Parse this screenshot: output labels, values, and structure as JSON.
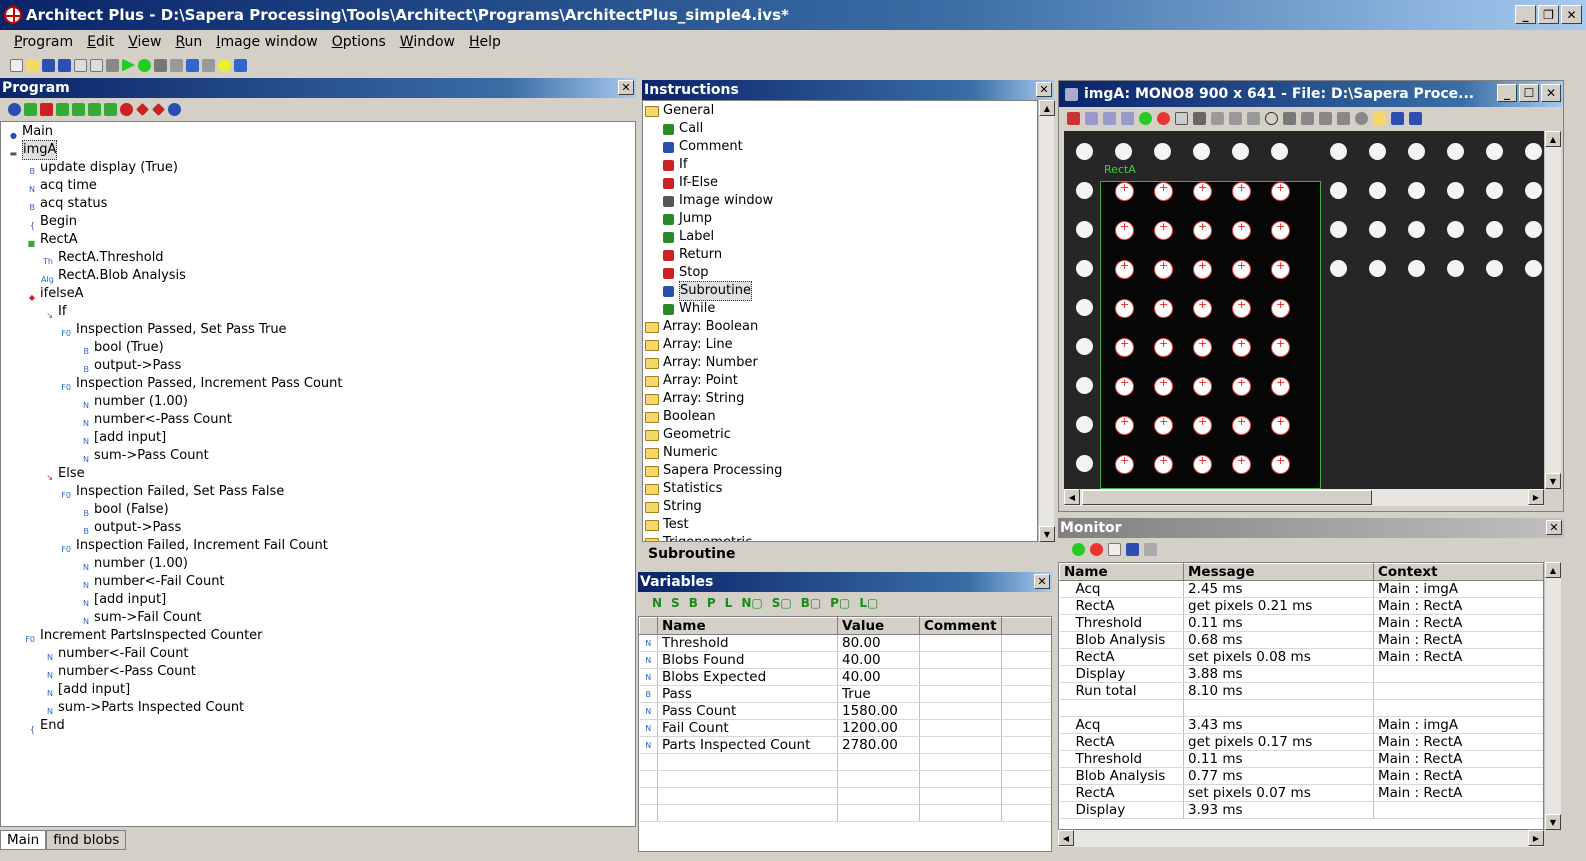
{
  "window": {
    "title": "Architect Plus - D:\\Sapera Processing\\Tools\\Architect\\Programs\\ArchitectPlus_simple4.ivs*"
  },
  "menu": [
    "Program",
    "Edit",
    "View",
    "Run",
    "Image window",
    "Options",
    "Window",
    "Help"
  ],
  "program_panel": {
    "title": "Program",
    "tree": [
      {
        "label": "Main",
        "icon": "subroutine-icon",
        "depth": 0
      },
      {
        "label": "imgA",
        "icon": "image-window-icon",
        "depth": 0
      },
      {
        "label": "update display (True)",
        "icon": "bool-icon",
        "depth": 1
      },
      {
        "label": "acq time",
        "icon": "number-icon",
        "depth": 1
      },
      {
        "label": "acq status",
        "icon": "bool-icon",
        "depth": 1
      },
      {
        "label": "Begin",
        "icon": "brace-icon",
        "depth": 1
      },
      {
        "label": "RectA",
        "icon": "rect-icon",
        "depth": 1
      },
      {
        "label": "RectA.Threshold",
        "icon": "threshold-icon",
        "depth": 2
      },
      {
        "label": "RectA.Blob Analysis",
        "icon": "algorithm-icon",
        "depth": 2
      },
      {
        "label": "ifelseA",
        "icon": "if-icon",
        "depth": 1
      },
      {
        "label": "If",
        "icon": "branch-icon",
        "depth": 2
      },
      {
        "label": "Inspection Passed, Set Pass True",
        "icon": "function-icon",
        "depth": 3
      },
      {
        "label": "bool (True)",
        "icon": "bool-icon",
        "depth": 4
      },
      {
        "label": "output->Pass",
        "icon": "bool-icon",
        "depth": 4
      },
      {
        "label": "Inspection Passed, Increment Pass Count",
        "icon": "function-icon",
        "depth": 3
      },
      {
        "label": "number (1.00)",
        "icon": "number-icon",
        "depth": 4
      },
      {
        "label": "number<-Pass Count",
        "icon": "number-icon",
        "depth": 4
      },
      {
        "label": "[add input]",
        "icon": "number-icon",
        "depth": 4
      },
      {
        "label": "sum->Pass Count",
        "icon": "number-icon",
        "depth": 4
      },
      {
        "label": "Else",
        "icon": "branch-red-icon",
        "depth": 2
      },
      {
        "label": "Inspection Failed, Set Pass False",
        "icon": "function-icon",
        "depth": 3
      },
      {
        "label": "bool (False)",
        "icon": "bool-icon",
        "depth": 4
      },
      {
        "label": "output->Pass",
        "icon": "bool-icon",
        "depth": 4
      },
      {
        "label": "Inspection Failed, Increment Fail Count",
        "icon": "function-icon",
        "depth": 3
      },
      {
        "label": "number (1.00)",
        "icon": "number-icon",
        "depth": 4
      },
      {
        "label": "number<-Fail Count",
        "icon": "number-icon",
        "depth": 4
      },
      {
        "label": "[add input]",
        "icon": "number-icon",
        "depth": 4
      },
      {
        "label": "sum->Fail Count",
        "icon": "number-icon",
        "depth": 4
      },
      {
        "label": "Increment PartsInspected Counter",
        "icon": "function-icon",
        "depth": 1
      },
      {
        "label": "number<-Fail Count",
        "icon": "number-icon",
        "depth": 2
      },
      {
        "label": "number<-Pass Count",
        "icon": "number-icon",
        "depth": 2
      },
      {
        "label": "[add input]",
        "icon": "number-icon",
        "depth": 2
      },
      {
        "label": "sum->Parts Inspected Count",
        "icon": "number-icon",
        "depth": 2
      },
      {
        "label": "End",
        "icon": "brace-icon",
        "depth": 1
      }
    ],
    "tabs": [
      "Main",
      "find blobs"
    ]
  },
  "instructions_panel": {
    "title": "Instructions",
    "root": "General",
    "general_items": [
      "Call",
      "Comment",
      "If",
      "If-Else",
      "Image window",
      "Jump",
      "Label",
      "Return",
      "Stop",
      "Subroutine",
      "While"
    ],
    "folders": [
      "Array: Boolean",
      "Array: Line",
      "Array: Number",
      "Array: Point",
      "Array: String",
      "Boolean",
      "Geometric",
      "Numeric",
      "Sapera Processing",
      "Statistics",
      "String",
      "Test",
      "Trigonometric"
    ],
    "selected": "Subroutine",
    "status": "Subroutine"
  },
  "variables_panel": {
    "title": "Variables",
    "filter_buttons": [
      "N",
      "S",
      "B",
      "P",
      "L",
      "N▢",
      "S▢",
      "B▢",
      "P▢",
      "L▢"
    ],
    "columns": [
      "Name",
      "Value",
      "Comment"
    ],
    "rows": [
      {
        "type": "N",
        "name": "Threshold",
        "value": "80.00"
      },
      {
        "type": "N",
        "name": "Blobs Found",
        "value": "40.00"
      },
      {
        "type": "N",
        "name": "Blobs Expected",
        "value": "40.00"
      },
      {
        "type": "B",
        "name": "Pass",
        "value": "True"
      },
      {
        "type": "N",
        "name": "Pass Count",
        "value": "1580.00"
      },
      {
        "type": "N",
        "name": "Fail Count",
        "value": "1200.00"
      },
      {
        "type": "N",
        "name": "Parts Inspected Count",
        "value": "2780.00"
      }
    ]
  },
  "image_window": {
    "title": "imgA: MONO8 900 x 641 - File: D:\\Sapera Proce...",
    "roi_label": "RectA"
  },
  "monitor_panel": {
    "title": "Monitor",
    "columns": [
      "Name",
      "Message",
      "Context"
    ],
    "rows": [
      {
        "name": "Acq",
        "message": "2.45 ms",
        "context": "Main : imgA"
      },
      {
        "name": "RectA",
        "message": "get pixels 0.21 ms",
        "context": "Main : RectA"
      },
      {
        "name": "Threshold",
        "message": "0.11 ms",
        "context": "Main : RectA"
      },
      {
        "name": "Blob Analysis",
        "message": "0.68 ms",
        "context": "Main : RectA"
      },
      {
        "name": "RectA",
        "message": "set pixels 0.08 ms",
        "context": "Main : RectA"
      },
      {
        "name": "Display",
        "message": "3.88 ms",
        "context": ""
      },
      {
        "name": "Run total",
        "message": "8.10 ms",
        "context": ""
      },
      {
        "name": "",
        "message": "",
        "context": ""
      },
      {
        "name": "Acq",
        "message": "3.43 ms",
        "context": "Main : imgA"
      },
      {
        "name": "RectA",
        "message": "get pixels 0.17 ms",
        "context": "Main : RectA"
      },
      {
        "name": "Threshold",
        "message": "0.11 ms",
        "context": "Main : RectA"
      },
      {
        "name": "Blob Analysis",
        "message": "0.77 ms",
        "context": "Main : RectA"
      },
      {
        "name": "RectA",
        "message": "set pixels 0.07 ms",
        "context": "Main : RectA"
      },
      {
        "name": "Display",
        "message": "3.93 ms",
        "context": ""
      }
    ]
  }
}
